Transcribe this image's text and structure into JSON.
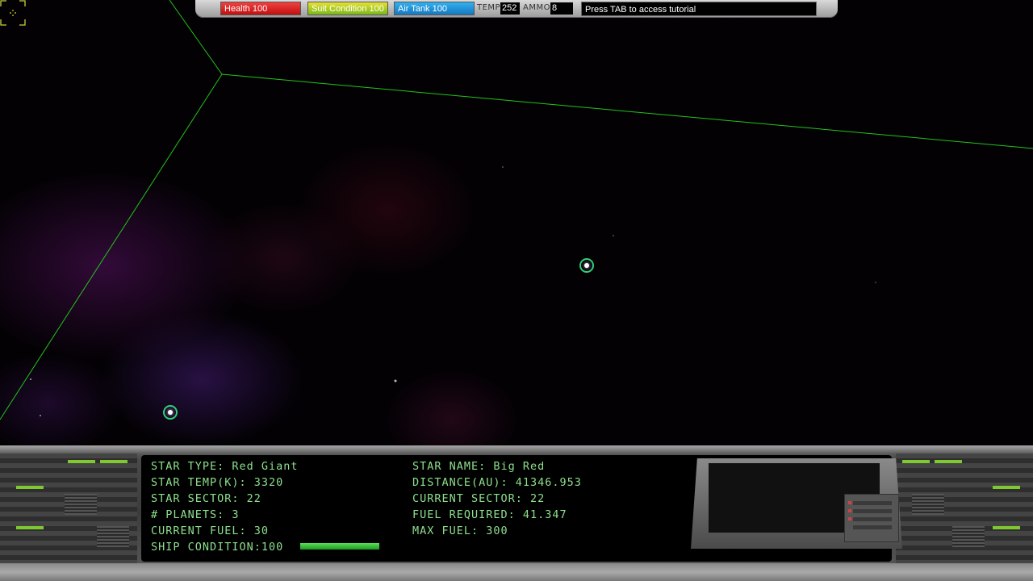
{
  "hud": {
    "health_label": "Health 100",
    "health_fraction": 1.0,
    "suit_label": "Suit Condition 100",
    "suit_fraction": 1.0,
    "air_label": "Air Tank 100",
    "air_fraction": 1.0,
    "temp_label": "TEMP",
    "temp_value": "252",
    "ammo_label": "AMMO",
    "ammo_value": "8",
    "tutorial_text": "Press TAB to access tutorial"
  },
  "star_info": {
    "type": "STAR TYPE: Red Giant",
    "temp": "STAR TEMP(K): 3320",
    "sector": "STAR SECTOR: 22",
    "planets": "# PLANETS: 3",
    "current_fuel": "CURRENT FUEL: 30",
    "ship_condition": "SHIP CONDITION:100",
    "ship_condition_fraction": 1.0,
    "name": "STAR NAME: Big Red",
    "distance": "DISTANCE(AU): 41346.953",
    "current_sector": "CURRENT SECTOR: 22",
    "fuel_required": "FUEL REQUIRED: 41.347",
    "max_fuel": "MAX FUEL: 300"
  },
  "colors": {
    "hud_text": "#8de08d",
    "grid_line": "#22c41a",
    "marker_ring": "#2fd07a",
    "health": "#e02828",
    "suit": "#b8d020",
    "air": "#2898d8"
  },
  "icons": [
    "star-marker-icon",
    "targeting-reticle-icon"
  ]
}
